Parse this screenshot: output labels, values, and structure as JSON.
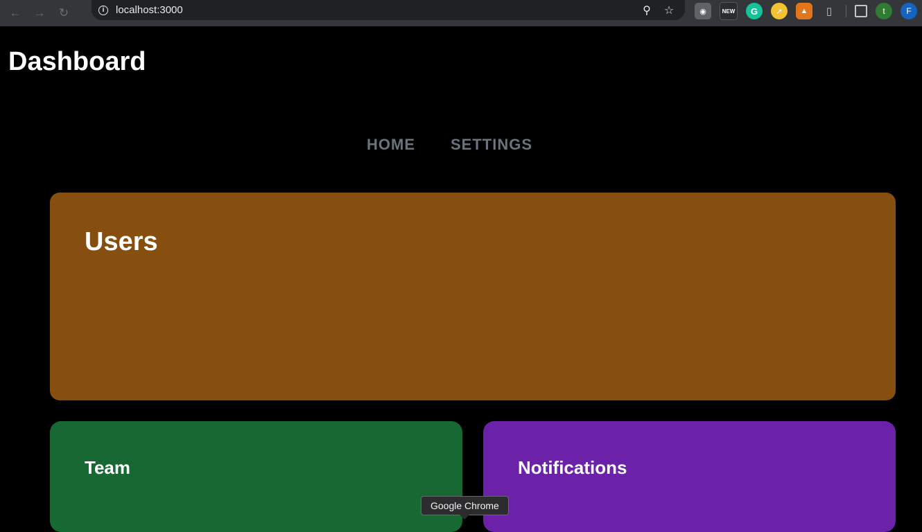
{
  "browser": {
    "url": "localhost:3000",
    "back_icon": "arrow-left-icon",
    "forward_icon": "arrow-right-icon",
    "reload_icon": "reload-icon",
    "info_glyph": "i",
    "new_badge": "NEW",
    "grammarly_glyph": "G",
    "profile_t": "t",
    "profile_f": "F",
    "tooltip": "Google Chrome"
  },
  "page": {
    "title": "Dashboard",
    "nav": [
      {
        "label": "HOME"
      },
      {
        "label": "SETTINGS"
      }
    ],
    "cards": {
      "users": {
        "title": "Users",
        "color": "#864f10"
      },
      "team": {
        "title": "Team",
        "color": "#186834"
      },
      "notifications": {
        "title": "Notifications",
        "color": "#6b21a8"
      }
    }
  }
}
